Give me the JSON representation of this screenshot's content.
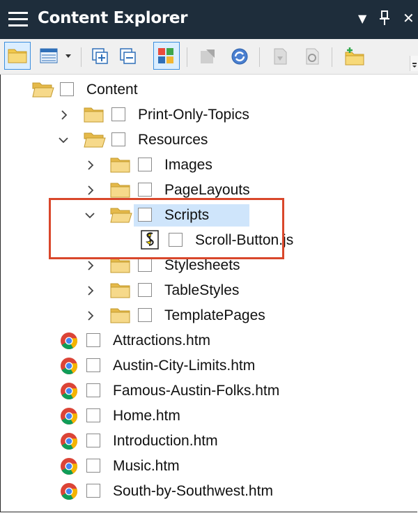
{
  "panel": {
    "title": "Content Explorer",
    "controls": {
      "dropdown": "▼",
      "pin": "📌",
      "close": "✕"
    }
  },
  "toolbar": {
    "icons": [
      "folder-icon",
      "view-icon",
      "dropdown-arrow-icon",
      "expand-all-icon",
      "collapse-all-icon",
      "show-files-icon",
      "open-icon",
      "sync-icon",
      "properties-icon",
      "edit-icon",
      "new-folder-icon"
    ]
  },
  "tree": {
    "items": [
      {
        "label": "Content",
        "type": "folder",
        "level": 0,
        "expanded": true,
        "chevron": "none"
      },
      {
        "label": "Print-Only-Topics",
        "type": "folder",
        "level": 1,
        "chevron": "right"
      },
      {
        "label": "Resources",
        "type": "folder",
        "level": 1,
        "chevron": "down"
      },
      {
        "label": "Images",
        "type": "folder",
        "level": 2,
        "chevron": "right"
      },
      {
        "label": "PageLayouts",
        "type": "folder",
        "level": 2,
        "chevron": "right"
      },
      {
        "label": "Scripts",
        "type": "folder",
        "level": 2,
        "chevron": "down",
        "selected": true
      },
      {
        "label": "Scroll-Button.js",
        "type": "js",
        "level": 3
      },
      {
        "label": "Stylesheets",
        "type": "folder",
        "level": 2,
        "chevron": "right"
      },
      {
        "label": "TableStyles",
        "type": "folder",
        "level": 2,
        "chevron": "right"
      },
      {
        "label": "TemplatePages",
        "type": "folder",
        "level": 2,
        "chevron": "right"
      },
      {
        "label": "Attractions.htm",
        "type": "htm",
        "level": 1
      },
      {
        "label": "Austin-City-Limits.htm",
        "type": "htm",
        "level": 1
      },
      {
        "label": "Famous-Austin-Folks.htm",
        "type": "htm",
        "level": 1
      },
      {
        "label": "Home.htm",
        "type": "htm",
        "level": 1
      },
      {
        "label": "Introduction.htm",
        "type": "htm",
        "level": 1
      },
      {
        "label": "Music.htm",
        "type": "htm",
        "level": 1
      },
      {
        "label": "South-by-Southwest.htm",
        "type": "htm",
        "level": 1
      }
    ]
  },
  "colors": {
    "titlebar": "#1e2d3b",
    "selection": "#cfe5fb",
    "callout": "#d9472b",
    "folder": "#f2c94c"
  }
}
